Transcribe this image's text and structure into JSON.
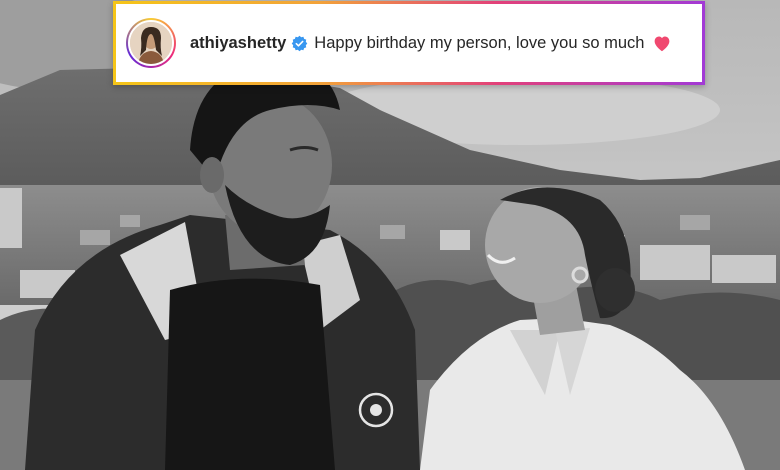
{
  "post": {
    "username": "athiyashetty",
    "caption": "Happy birthday my person, love you so much",
    "verified_icon": "verified-badge-icon",
    "heart_icon": "heart-icon",
    "heart_color": "#f0486f",
    "verified_color": "#3897f0"
  }
}
